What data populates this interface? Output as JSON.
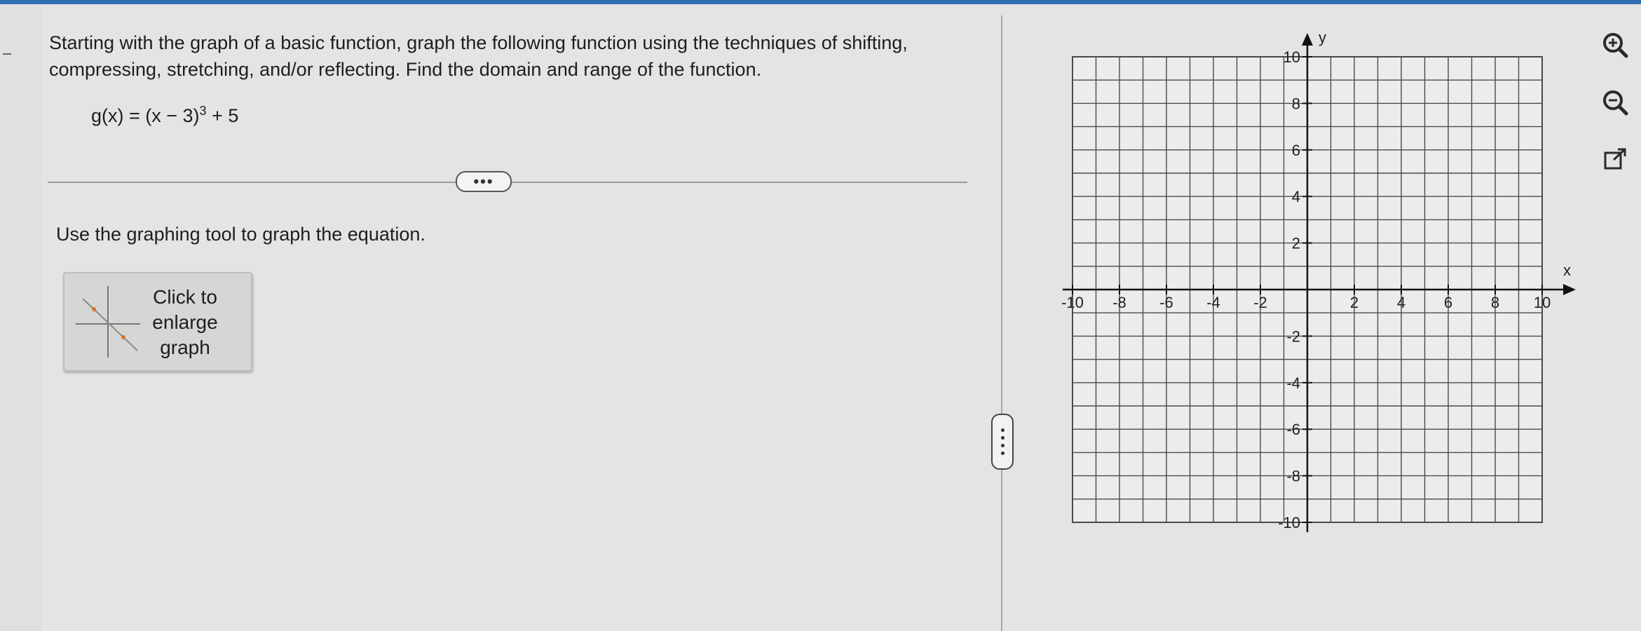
{
  "question": {
    "instructions": "Starting with the graph of a basic function, graph the following function using the techniques of shifting, compressing, stretching, and/or reflecting. Find the domain and range of the function.",
    "equation": {
      "lhs": "g(x) = (x − 3)",
      "exponent": "3",
      "rhs": " + 5"
    },
    "expand_label": "•••",
    "prompt": "Use the graphing tool to graph the equation.",
    "enlarge_button": {
      "line1": "Click to",
      "line2": "enlarge",
      "line3": "graph"
    }
  },
  "graph": {
    "x_axis_label": "x",
    "y_axis_label": "y",
    "x_range": [
      -10,
      10
    ],
    "y_range": [
      -10,
      10
    ],
    "grid_step": 1,
    "x_tick_labels": [
      "-10",
      "-8",
      "-6",
      "-4",
      "-2",
      "2",
      "4",
      "6",
      "8",
      "10"
    ],
    "x_tick_values": [
      -10,
      -8,
      -6,
      -4,
      -2,
      2,
      4,
      6,
      8,
      10
    ],
    "y_tick_labels": [
      "10",
      "8",
      "6",
      "4",
      "2",
      "-2",
      "-4",
      "-6",
      "-8",
      "-10"
    ],
    "y_tick_values": [
      10,
      8,
      6,
      4,
      2,
      -2,
      -4,
      -6,
      -8,
      -10
    ]
  },
  "tools": {
    "zoom_in": "zoom-in-icon",
    "zoom_out": "zoom-out-icon",
    "popout": "external-link-icon"
  },
  "colors": {
    "accent": "#2f6fb5",
    "grid": "#4a4a4a",
    "background": "#e4e4e2"
  }
}
